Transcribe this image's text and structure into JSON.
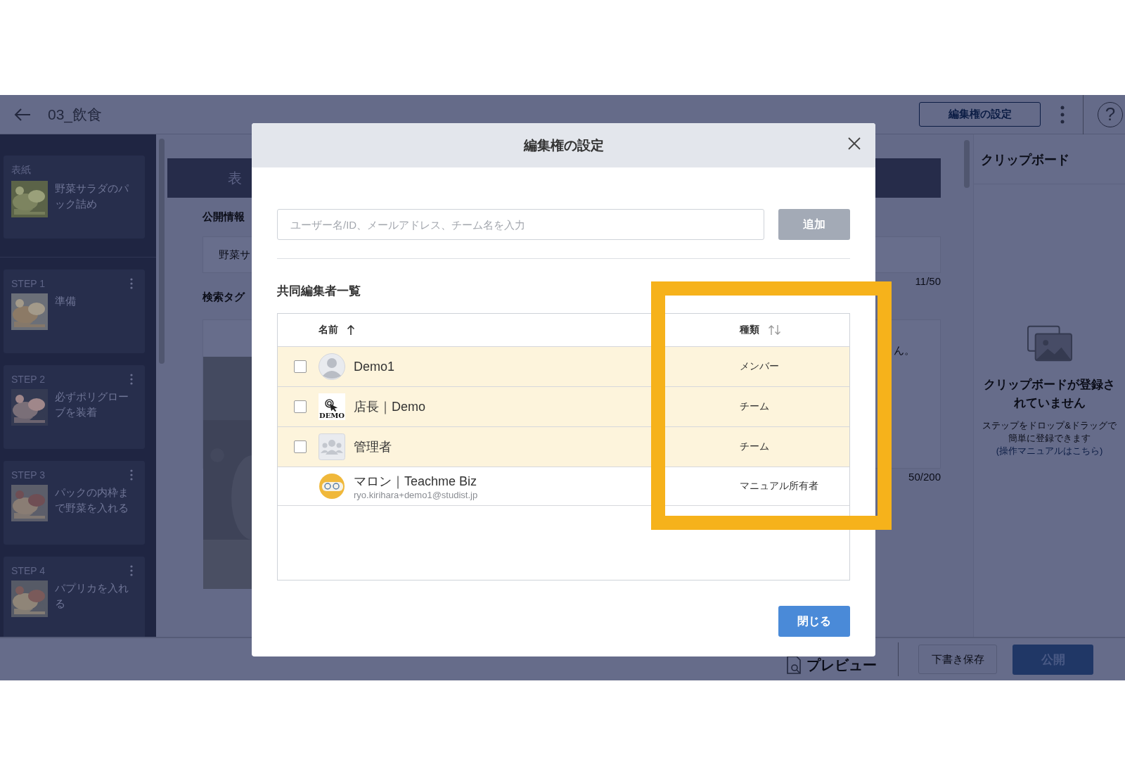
{
  "app_bar": {
    "title": "03_飲食",
    "edit_button": "編集権の設定",
    "help": "?"
  },
  "sidebar": {
    "cover": {
      "label": "表紙",
      "title": "野菜サラダのパック詰め"
    },
    "steps": [
      {
        "label": "STEP 1",
        "title": "準備"
      },
      {
        "label": "STEP 2",
        "title": "必ずポリグローブを装着"
      },
      {
        "label": "STEP 3",
        "title": "パックの内枠まで野菜を入れる"
      },
      {
        "label": "STEP 4",
        "title": "パプリカを入れる"
      }
    ]
  },
  "editor": {
    "tab": "表",
    "public_info_label": "公開情報",
    "title_field": "野菜サ",
    "title_counter": "11/50",
    "tags_label": "検索タグ",
    "description_tail": "ん。",
    "description_counter": "50/200"
  },
  "clipboard": {
    "title": "クリップボード",
    "empty_title": "クリップボードが登録されていません",
    "empty_hint": "ステップをドロップ&ドラッグで簡単に登録できます",
    "manual_link": "(操作マニュアルはこちら)"
  },
  "footer": {
    "preview": "プレビュー",
    "save_draft": "下書き保存",
    "publish": "公開"
  },
  "dialog": {
    "title": "編集権の設定",
    "search": {
      "placeholder": "ユーザー名/ID、メールアドレス、チーム名を入力"
    },
    "add_button": {
      "label": "追加",
      "disabled": true
    },
    "list_title": "共同編集者一覧",
    "columns": [
      {
        "label": "名前",
        "kind": "sorted_ascending"
      },
      {
        "label": "種類",
        "kind": "sortable"
      }
    ],
    "rows": [
      {
        "name": "Demo1",
        "type": "メンバー",
        "avatar": {
          "kind": "person"
        },
        "selectable": true,
        "checked": false
      },
      {
        "name": "店長｜Demo",
        "type": "チーム",
        "avatar": {
          "kind": "logo",
          "label": "DEMO"
        },
        "selectable": true,
        "checked": false
      },
      {
        "name": "管理者",
        "type": "チーム",
        "avatar": {
          "kind": "group"
        },
        "selectable": true,
        "checked": false
      },
      {
        "name": "マロン｜Teachme Biz",
        "email": "ryo.kirihara+demo1@studist.jp",
        "type": "マニュアル所有者",
        "avatar": {
          "kind": "mascot"
        },
        "selectable": false
      }
    ],
    "close_button": "閉じる"
  }
}
